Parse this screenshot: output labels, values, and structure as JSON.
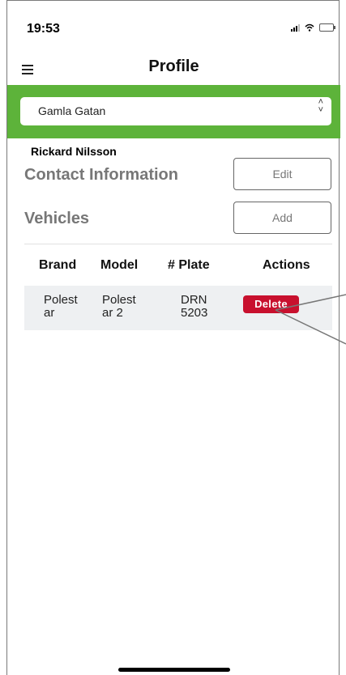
{
  "status_bar": {
    "time": "19:53"
  },
  "header": {
    "title": "Profile"
  },
  "location": {
    "selected": "Gamla Gatan"
  },
  "user": {
    "name": "Rickard Nilsson"
  },
  "contact": {
    "title": "Contact Information",
    "edit_label": "Edit"
  },
  "vehicles": {
    "title": "Vehicles",
    "add_label": "Add",
    "columns": [
      "Brand",
      "Model",
      "# Plate",
      "Actions"
    ],
    "rows": [
      {
        "brand": [
          "Polest",
          "ar"
        ],
        "model": [
          "Polest",
          "ar 2"
        ],
        "plate": [
          "DRN",
          "5203"
        ],
        "action_label": "Delete"
      }
    ]
  },
  "colors": {
    "accent": "#5db33a",
    "delete": "#c8102e",
    "row_bg": "#eef0f2"
  }
}
